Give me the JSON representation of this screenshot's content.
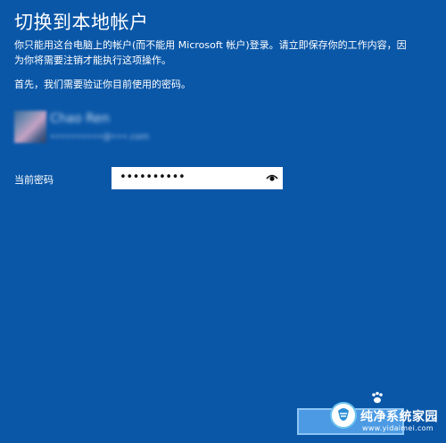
{
  "dialog": {
    "title": "切换到本地帐户",
    "intro_line1": "你只能用这台电脑上的帐户(而不能用 Microsoft 帐户)登录。请立即保存你的工作内容，因",
    "intro_line2": "为你将需要注销才能执行这项操作。",
    "first_step": "首先，我们需要验证你目前使用的密码。"
  },
  "account": {
    "name": "Chao Ren",
    "email": "••••••••••@•••.com"
  },
  "password": {
    "label": "当前密码",
    "value": "••••••••••"
  },
  "watermark": {
    "text": "纯净系统家园",
    "url": "www.yidaimei.com"
  },
  "colors": {
    "background": "#0a57a8",
    "button": "#4b9ae3"
  }
}
